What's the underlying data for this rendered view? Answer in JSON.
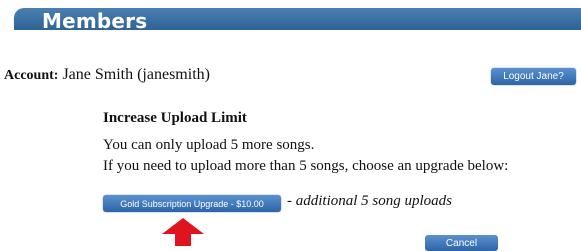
{
  "header": {
    "title": "Members",
    "color": "#3a6fa4"
  },
  "account": {
    "label": "Account:",
    "value": "Jane Smith (janesmith)",
    "logout_label": "Logout Jane?"
  },
  "upload": {
    "title": "Increase Upload Limit",
    "line1": "You can only upload 5 more songs.",
    "line2": "If you need to upload more than 5 songs, choose an upgrade below:",
    "upgrade_label": "Gold Subscription Upgrade - $10.00",
    "upgrade_desc": "- additional 5 song uploads",
    "cancel_label": "Cancel"
  },
  "annotation": {
    "icon": "red-up-arrow",
    "color": "#e0141e"
  }
}
